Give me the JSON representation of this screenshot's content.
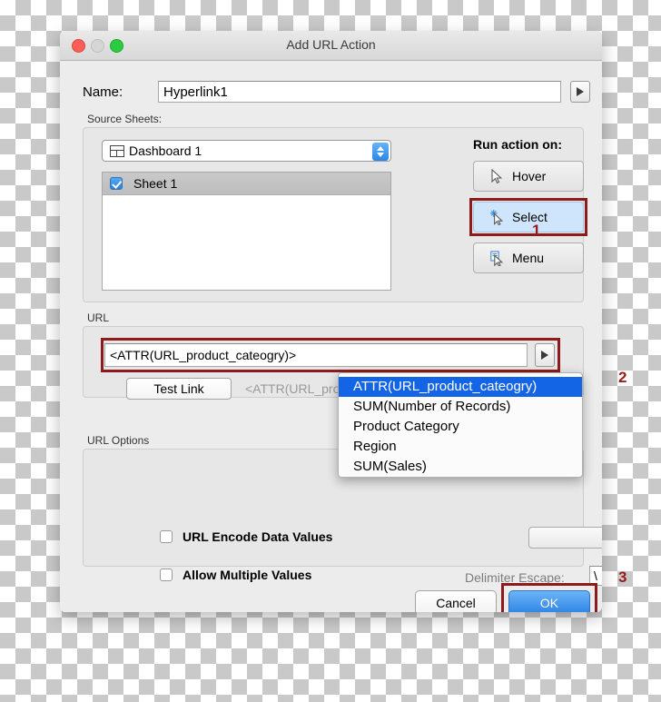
{
  "window": {
    "title": "Add URL Action",
    "traffic_lights": [
      "close",
      "minimize",
      "zoom"
    ]
  },
  "name_row": {
    "label": "Name:",
    "value": "Hyperlink1",
    "placeholder": "",
    "arrow_icon": "play-triangle-icon"
  },
  "source_sheets": {
    "group_label": "Source Sheets:",
    "dashboard_select": {
      "value": "Dashboard 1",
      "icon": "dashboard-grid-icon",
      "stepper_icon": "up-down-stepper-icon"
    },
    "sheets": [
      {
        "label": "Sheet 1",
        "checked": true
      }
    ]
  },
  "run_action": {
    "label": "Run action on:",
    "buttons": [
      {
        "label": "Hover",
        "icon": "cursor-arrow-icon",
        "selected": false
      },
      {
        "label": "Select",
        "icon": "cursor-arrow-sparkle-icon",
        "selected": true
      },
      {
        "label": "Menu",
        "icon": "cursor-arrow-menu-icon",
        "selected": false
      }
    ]
  },
  "url_section": {
    "group_label": "URL",
    "value": "<ATTR(URL_product_cateogry)>",
    "arrow_icon": "play-triangle-icon",
    "test_link_label": "Test Link",
    "preview_text": "<ATTR(URL_prod"
  },
  "dropdown": {
    "items": [
      "ATTR(URL_product_cateogry)",
      "SUM(Number of Records)",
      "Product Category",
      "Region",
      "SUM(Sales)"
    ],
    "selected_index": 0,
    "highlight_color": "#1464e6"
  },
  "url_options": {
    "group_label": "URL Options",
    "checkboxes": [
      {
        "label": "URL Encode Data Values",
        "checked": false
      },
      {
        "label": "Allow Multiple Values",
        "checked": false
      }
    ],
    "delimiter": {
      "label": "Delimiter Escape:",
      "value": "\\"
    }
  },
  "footer": {
    "cancel_label": "Cancel",
    "ok_label": "OK"
  },
  "annotations": {
    "one": "1",
    "two": "2",
    "three": "3",
    "color": "#9b1b1b"
  }
}
